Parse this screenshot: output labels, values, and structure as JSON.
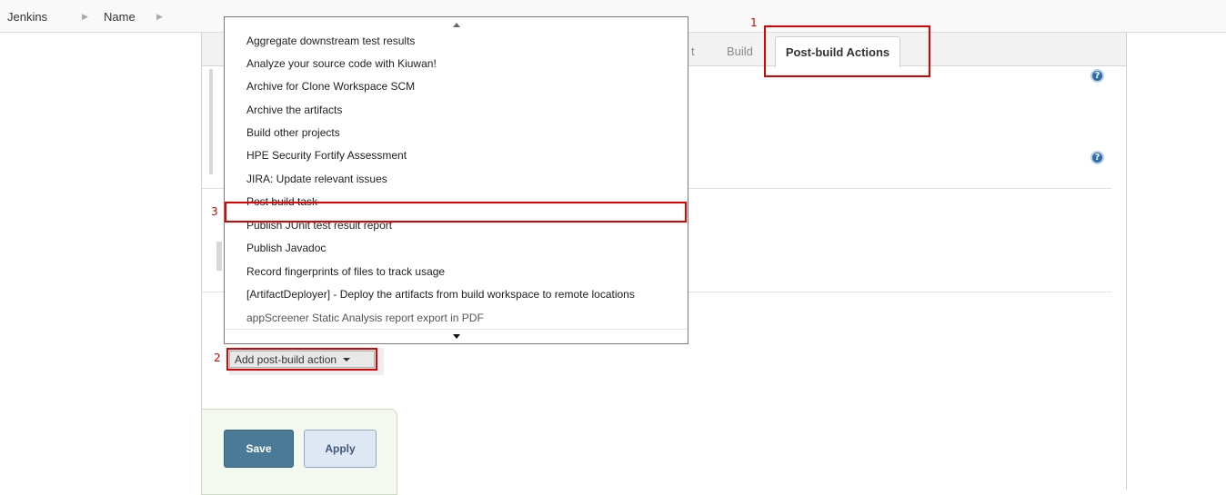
{
  "breadcrumb": {
    "items": [
      "Jenkins",
      "Name"
    ]
  },
  "tabs": {
    "partial_label": "t",
    "build_label": "Build",
    "active_label": "Post-build Actions"
  },
  "icons": {
    "help": "?"
  },
  "dropdown": {
    "items": [
      "Aggregate downstream test results",
      "Analyze your source code with Kiuwan!",
      "Archive for Clone Workspace SCM",
      "Archive the artifacts",
      "Build other projects",
      "HPE Security Fortify Assessment",
      "JIRA: Update relevant issues",
      "Post build task",
      "Publish JUnit test result report",
      "Publish Javadoc",
      "Record fingerprints of files to track usage",
      "[ArtifactDeployer] - Deploy the artifacts from build workspace to remote locations",
      "appScreener Static Analysis report export in PDF"
    ],
    "highlighted_item": "Post build task"
  },
  "annotations": {
    "marker_1": "1",
    "marker_2": "2",
    "marker_3": "3",
    "color": "#e00000"
  },
  "actions": {
    "add_post_build_label": "Add post-build action",
    "save_label": "Save",
    "apply_label": "Apply"
  },
  "colors": {
    "save_button": "#4a7a96",
    "apply_button": "#dde8f4",
    "help_icon": "#2f6ea8"
  }
}
